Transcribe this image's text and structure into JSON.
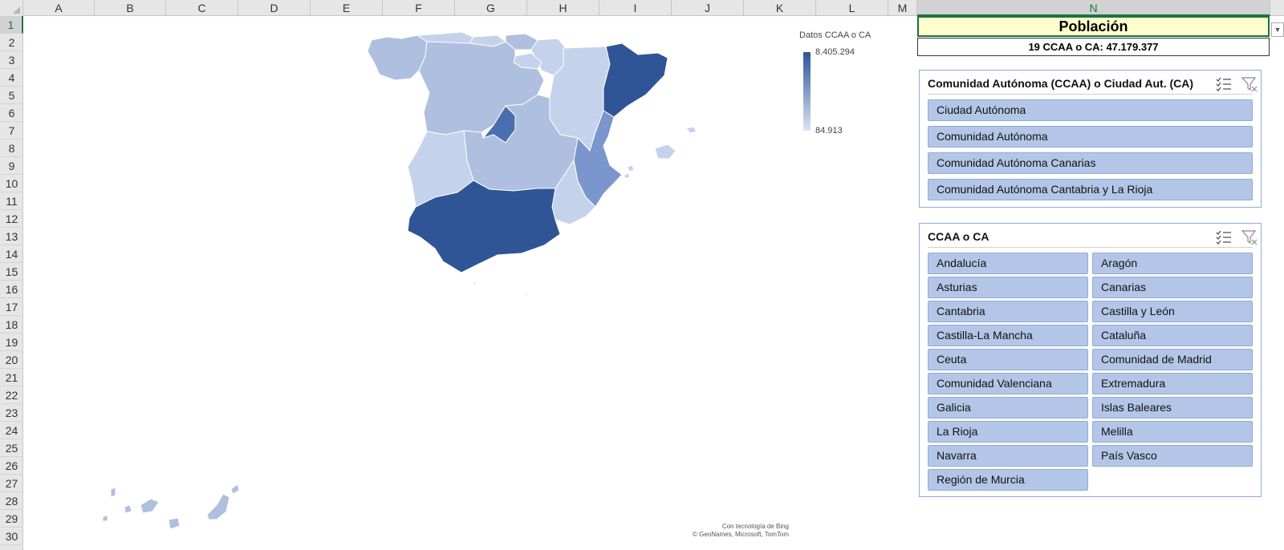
{
  "columns": [
    "A",
    "B",
    "C",
    "D",
    "E",
    "F",
    "G",
    "H",
    "I",
    "J",
    "K",
    "L",
    "M",
    "N"
  ],
  "rows": [
    "1",
    "2",
    "3",
    "4",
    "5",
    "6",
    "7",
    "8",
    "9",
    "10",
    "11",
    "12",
    "13",
    "14",
    "15",
    "16",
    "17",
    "18",
    "19",
    "20",
    "21",
    "22",
    "23",
    "24",
    "25",
    "26",
    "27",
    "28",
    "29",
    "30"
  ],
  "selected_column": "N",
  "selected_row": "1",
  "cells": {
    "title": "Población",
    "total": "19 CCAA o CA: 47.179.377"
  },
  "map": {
    "legend_title": "Datos CCAA o CA",
    "legend_max": "8.405.294",
    "legend_min": "84.913",
    "attribution_line1": "Con tecnología de Bing",
    "attribution_line2": "© GeoNames, Microsoft, TomTom",
    "colors": {
      "dark": "#2f5597",
      "mid": "#7a96cc",
      "light": "#aebfdf",
      "lighter": "#c5d2eb"
    }
  },
  "slicer1": {
    "title": "Comunidad Autónoma (CCAA) o Ciudad Aut. (CA)",
    "multiselect_icon": "multi-select-icon",
    "clear_filter_icon": "clear-filter-icon",
    "items": [
      "Ciudad Autónoma",
      "Comunidad Autónoma",
      "Comunidad Autónoma Canarias",
      "Comunidad Autónoma Cantabria y La Rioja"
    ]
  },
  "slicer2": {
    "title": "CCAA o CA",
    "multiselect_icon": "multi-select-icon",
    "clear_filter_icon": "clear-filter-icon",
    "items": [
      "Andalucía",
      "Aragón",
      "Asturias",
      "Canarias",
      "Cantabria",
      "Castilla y León",
      "Castilla-La Mancha",
      "Cataluña",
      "Ceuta",
      "Comunidad de Madrid",
      "Comunidad Valenciana",
      "Extremadura",
      "Galicia",
      "Islas Baleares",
      "La Rioja",
      "Melilla",
      "Navarra",
      "País Vasco",
      "Región de Murcia"
    ]
  }
}
